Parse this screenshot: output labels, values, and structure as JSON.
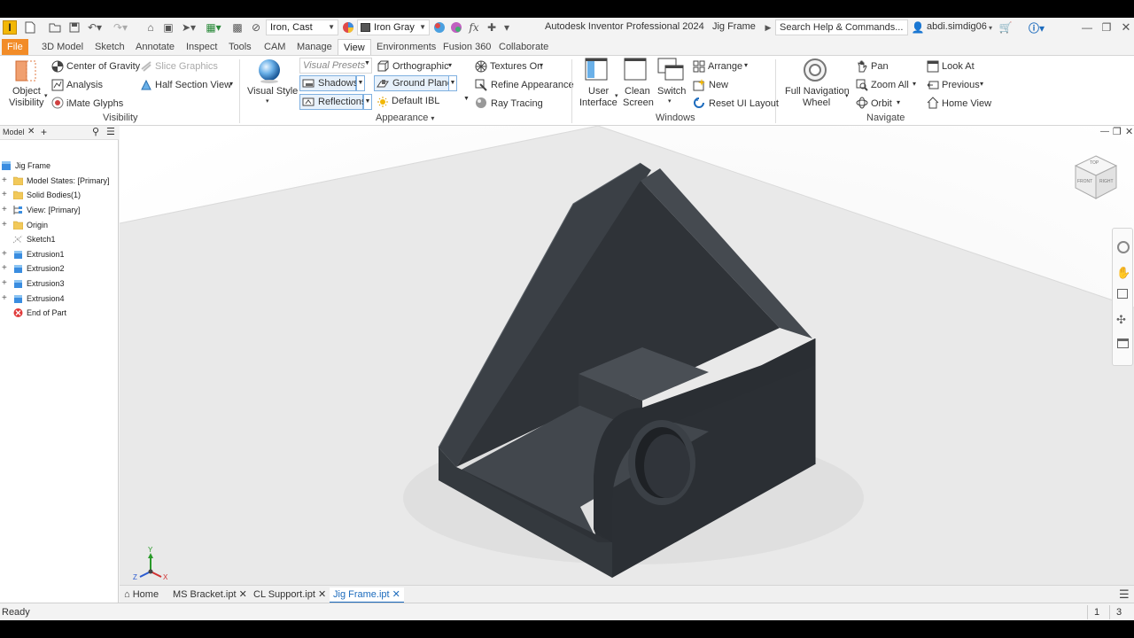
{
  "app": {
    "title": "Autodesk Inventor Professional 2024",
    "document": "Jig Frame",
    "logo_letter": "I"
  },
  "quick_access": {
    "material": "Iron, Cast",
    "appearance": "Iron Gray",
    "fx": "fx"
  },
  "search": {
    "placeholder": "Search Help & Commands..."
  },
  "user": {
    "name": "abdi.simdig06"
  },
  "tabs": [
    {
      "label": "File"
    },
    {
      "label": "3D Model"
    },
    {
      "label": "Sketch"
    },
    {
      "label": "Annotate"
    },
    {
      "label": "Inspect"
    },
    {
      "label": "Tools"
    },
    {
      "label": "CAM"
    },
    {
      "label": "Manage"
    },
    {
      "label": "View"
    },
    {
      "label": "Environments"
    },
    {
      "label": "Fusion 360"
    },
    {
      "label": "Collaborate"
    }
  ],
  "ribbon": {
    "visibility": {
      "title": "Visibility",
      "object_visibility_1": "Object",
      "object_visibility_2": "Visibility",
      "center_of_gravity": "Center of Gravity",
      "slice_graphics": "Slice Graphics",
      "analysis": "Analysis",
      "half_section": "Half Section View",
      "imate_glyphs": "iMate Glyphs"
    },
    "appearance": {
      "title": "Appearance",
      "visual_style": "Visual Style",
      "visual_presets": "Visual Presets",
      "orthographic": "Orthographic",
      "textures_on": "Textures On",
      "shadows": "Shadows",
      "ground_plane": "Ground Plane",
      "refine_appearance": "Refine Appearance",
      "reflections": "Reflections",
      "default_ibl": "Default IBL",
      "ray_tracing": "Ray Tracing"
    },
    "windows": {
      "title": "Windows",
      "user_interface_1": "User",
      "user_interface_2": "Interface",
      "clean_screen_1": "Clean",
      "clean_screen_2": "Screen",
      "switch": "Switch",
      "arrange": "Arrange",
      "new": "New",
      "reset_ui": "Reset UI Layout"
    },
    "navigate": {
      "title": "Navigate",
      "full_nav_1": "Full Navigation",
      "full_nav_2": "Wheel",
      "pan": "Pan",
      "zoom_all": "Zoom All",
      "orbit": "Orbit",
      "look_at": "Look At",
      "previous": "Previous",
      "home_view": "Home View"
    }
  },
  "browser": {
    "tab": "Model",
    "items": [
      {
        "label": "Jig Frame",
        "icon": "part-icon"
      },
      {
        "label": "Model States: [Primary]",
        "icon": "folder-icon"
      },
      {
        "label": "Solid Bodies(1)",
        "icon": "folder-icon"
      },
      {
        "label": "View: [Primary]",
        "icon": "view-icon"
      },
      {
        "label": "Origin",
        "icon": "folder-icon"
      },
      {
        "label": "Sketch1",
        "icon": "sketch-icon"
      },
      {
        "label": "Extrusion1",
        "icon": "extrusion-icon"
      },
      {
        "label": "Extrusion2",
        "icon": "extrusion-icon"
      },
      {
        "label": "Extrusion3",
        "icon": "extrusion-icon"
      },
      {
        "label": "Extrusion4",
        "icon": "extrusion-icon"
      },
      {
        "label": "End of Part",
        "icon": "end-of-part-icon"
      }
    ]
  },
  "viewcube": {
    "top": "TOP",
    "front": "FRONT",
    "right": "RIGHT"
  },
  "triad": {
    "x": "X",
    "y": "Y",
    "z": "Z"
  },
  "doc_tabs": [
    {
      "label": "Home"
    },
    {
      "label": "MS Bracket.ipt"
    },
    {
      "label": "CL Support.ipt"
    },
    {
      "label": "Jig Frame.ipt"
    }
  ],
  "status": {
    "text": "Ready",
    "num1": "1",
    "num2": "3"
  },
  "colors": {
    "accent": "#f28c28",
    "model": "#3a3f44",
    "selection": "#1c6bbd"
  }
}
